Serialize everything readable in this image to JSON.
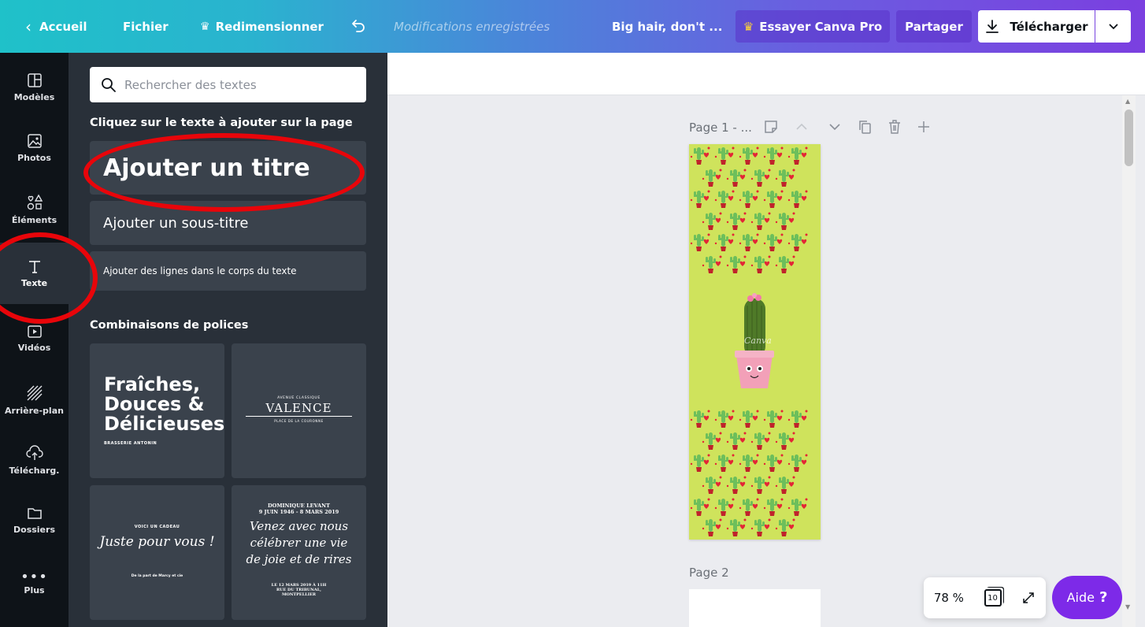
{
  "topbar": {
    "back_label": "Accueil",
    "file_label": "Fichier",
    "resize_label": "Redimensionner",
    "saved_status": "Modifications enregistrées",
    "doc_title": "Big hair, don't ...",
    "pro_label": "Essayer Canva Pro",
    "share_label": "Partager",
    "download_label": "Télécharger"
  },
  "rail": {
    "items": [
      {
        "label": "Modèles",
        "icon": "layout-icon"
      },
      {
        "label": "Photos",
        "icon": "image-icon"
      },
      {
        "label": "Éléments",
        "icon": "shapes-icon"
      },
      {
        "label": "Texte",
        "icon": "text-icon"
      },
      {
        "label": "Vidéos",
        "icon": "video-icon"
      },
      {
        "label": "Arrière-plan",
        "icon": "background-icon"
      },
      {
        "label": "Télécharg.",
        "icon": "upload-icon"
      },
      {
        "label": "Dossiers",
        "icon": "folder-icon"
      },
      {
        "label": "Plus",
        "icon": "more-icon"
      }
    ],
    "active": "Texte"
  },
  "panel": {
    "search_placeholder": "Rechercher des textes",
    "click_hint": "Cliquez sur le texte à ajouter sur la page",
    "add_title": "Ajouter un titre",
    "add_subtitle": "Ajouter un sous-titre",
    "add_body": "Ajouter des lignes dans le corps du texte",
    "combos_title": "Combinaisons de polices",
    "combos": [
      {
        "main_1": "Fraîches,",
        "main_2": "Douces &",
        "main_3": "Délicieuses",
        "small": "BRASSERIE ANTONIN"
      },
      {
        "top": "AVENUE CLASSIQUE",
        "main": "VALENCE",
        "bottom": "PLACE DE LA COURONNE"
      },
      {
        "top": "VOICI UN CADEAU",
        "main": "Juste pour vous !",
        "bottom": "De la part de Marcy et cie"
      },
      {
        "line1": "DOMINIQUE LEVANT",
        "line2": "9 JUIN 1946 - 8 MARS 2019",
        "script1": "Venez avec nous",
        "script2": "célébrer une vie",
        "script3": "de joie et de rires",
        "foot1": "LE 12 MARS 2019 À 11H",
        "foot2": "RUE DU TRIBUNAL,",
        "foot3": "MONTPELLIER"
      }
    ]
  },
  "editor": {
    "page1_label": "Page 1 - ...",
    "page2_label": "Page 2",
    "watermark": "Canva",
    "zoom": "78 %",
    "page_count": "10",
    "help_label": "Aide",
    "help_symbol": "?"
  },
  "colors": {
    "accent": "#7d2ae8",
    "highlight_ring": "#e8050a",
    "page_bg": "#cfe35c",
    "panel_bg": "#293039",
    "rail_bg": "#0e1318"
  }
}
